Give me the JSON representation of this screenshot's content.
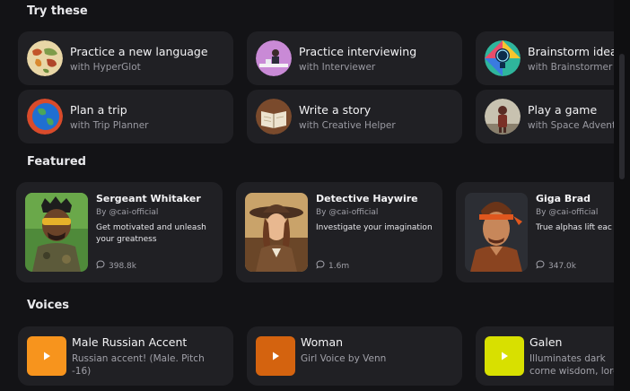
{
  "sections": {
    "try_these": "Try these",
    "featured": "Featured",
    "voices": "Voices"
  },
  "try_these": [
    {
      "title": "Practice a new language",
      "subtitle": "with HyperGlot",
      "icon": "world-map-icon"
    },
    {
      "title": "Practice interviewing",
      "subtitle": "with Interviewer",
      "icon": "interview-desk-icon"
    },
    {
      "title": "Brainstorm ideas",
      "subtitle": "with Brainstormer",
      "icon": "lightbulb-icon"
    },
    {
      "title": "Plan a trip",
      "subtitle": "with Trip Planner",
      "icon": "globe-icon"
    },
    {
      "title": "Write a story",
      "subtitle": "with Creative Helper",
      "icon": "open-book-icon"
    },
    {
      "title": "Play a game",
      "subtitle": "with Space Adventure",
      "icon": "astronaut-icon"
    }
  ],
  "featured": [
    {
      "name": "Sergeant Whitaker",
      "by": "By @cai-official",
      "description": "Get motivated and unleash your greatness",
      "count": "398.8k"
    },
    {
      "name": "Detective Haywire",
      "by": "By @cai-official",
      "description": "Investigate your imagination",
      "count": "1.6m"
    },
    {
      "name": "Giga Brad",
      "by": "By @cai-official",
      "description": "True alphas lift eac",
      "count": "347.0k"
    }
  ],
  "voices": [
    {
      "title": "Male Russian Accent",
      "subtitle": "Russian accent! (Male. Pitch -16)",
      "color": "#f7941d"
    },
    {
      "title": "Woman",
      "subtitle": "Girl Voice by Venn",
      "color": "#d4630f"
    },
    {
      "title": "Galen",
      "subtitle": "Illuminates dark corne wisdom, lore and lege",
      "color": "#d8e000"
    }
  ]
}
